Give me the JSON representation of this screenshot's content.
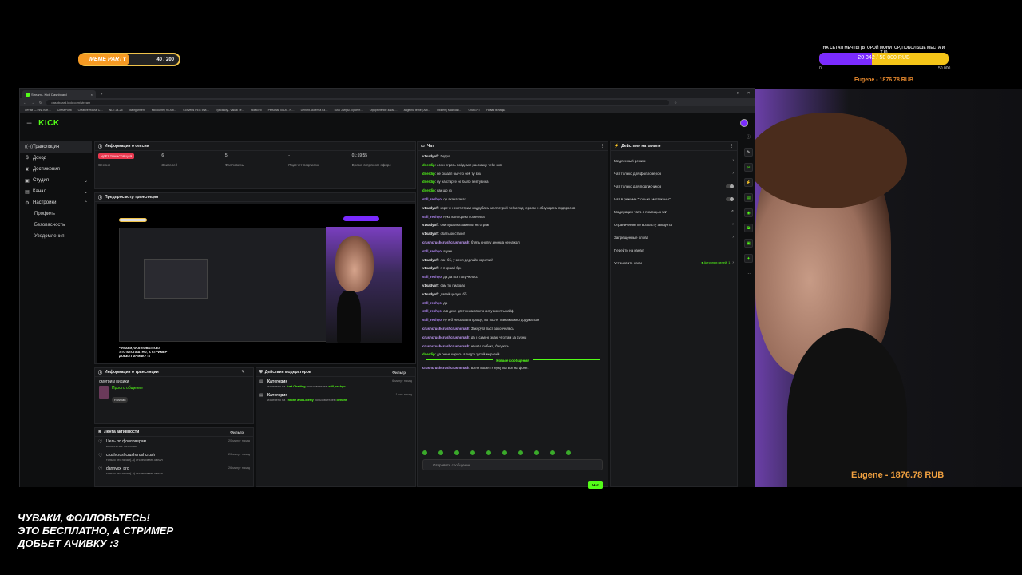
{
  "overlay": {
    "meme_label": "MEME PARTY",
    "meme_count": "40 / 200",
    "goal_title": "НА СЕТАП МЕЧТЫ (ВТОРОЙ МОНИТОР, ПОБОЛЬШЕ МЕСТА И Т.Д)",
    "goal_text": "20 342 / 50 000 RUB",
    "goal_progress": 0.41,
    "goal_min": "0",
    "goal_max": "50 000",
    "goal_donor": "Eugene - 1876.78 RUB",
    "cam_donor": "Eugene - 1876.78 RUB",
    "bottom_line1": "ЧУВАКИ, ФОЛЛОВЬТЕСЬ!",
    "bottom_line2": "ЭТО БЕСПЛАТНО, А СТРИМЕР",
    "bottom_line3": "ДОБЬЕТ АЧИВКУ :3"
  },
  "browser": {
    "tab_title": "Stream - Kick Dashboard",
    "url": "dashboard.kick.com/stream",
    "bookmarks": [
      "Летим — Inna Кон…",
      "ChessPoint",
      "Creative House C…",
      "NLE 24-25",
      "Mailfgarment",
      "Midjourney 96 Arti…",
      "Converts PEG Ima…",
      "Eyecandy - Visual Te…",
      "Новости",
      "Personal To Do - N…",
      "Dendrit Akdemia Kli…",
      "DAO 2 игры. Проект…",
      "Оформление заказ…",
      "angelina teme | Arti…",
      "Обмен | Майбокс…",
      "ChatGPT",
      "Новая вкладка"
    ]
  },
  "kick": {
    "logo": "KICK",
    "sidebar": [
      {
        "label": "Трансляция",
        "icon": "broadcast-icon"
      },
      {
        "label": "Доход",
        "icon": "dollar-icon"
      },
      {
        "label": "Достижения",
        "icon": "trophy-icon"
      },
      {
        "label": "Студия",
        "icon": "studio-icon"
      },
      {
        "label": "Канал",
        "icon": "channel-icon"
      },
      {
        "label": "Настройки",
        "icon": "gear-icon"
      }
    ],
    "settings_sub": [
      "Профиль",
      "Безопасность",
      "Уведомления"
    ],
    "session": {
      "title": "Информация о сессии",
      "live": "ИДЁТ ТРАНСЛЯЦИЯ",
      "session_label": "Сессия",
      "viewers": "6",
      "viewers_label": "Зрителей",
      "followers": "5",
      "followers_label": "Фолловеры",
      "subs": "-",
      "subs_label": "Подсчет подписок",
      "time": "01:59:55",
      "time_label": "Время в прямом эфире"
    },
    "preview": {
      "title": "Предпросмотр трансляции",
      "overlay_text_1": "ЧУВАКИ, ФОЛЛОВЬТЕСЬ!",
      "overlay_text_2": "ЭТО БЕСПЛАТНО, А СТРИМЕР",
      "overlay_text_3": "ДОБЬЕТ АЧИВКУ :3"
    },
    "stream_info": {
      "title": "Информация о трансляции",
      "stream_title": "смотрим видики",
      "category": "Просто общение",
      "tag": "Russian"
    },
    "mod_actions": {
      "title": "Действия модераторов",
      "filter": "Фильтр",
      "rows": [
        {
          "title": "Категория",
          "prefix": "изменено на",
          "value": "Just Chatting",
          "mid": "пользователем",
          "user": "still_reshyo",
          "time": "6 минут назад"
        },
        {
          "title": "Категория",
          "prefix": "изменено на",
          "value": "Throne and Liberty",
          "mid": "пользователем",
          "user": "dendrit",
          "time": "1 час назад"
        }
      ]
    },
    "activity": {
      "title": "Лента активности",
      "filter": "Фильтр",
      "rows": [
        {
          "title": "Цель по фолловерам",
          "desc": "исполнение гипотезы",
          "time": "20 минут назад",
          "icon": "heart-icon"
        },
        {
          "title": "crushcrushcrushcrushcrush",
          "desc": "только что начал(-а) отслеживать канал",
          "time": "20 минут назад",
          "icon": "heart-icon"
        },
        {
          "title": "dannyxx_pro",
          "desc": "только что начал(-а) отслеживать канал",
          "time": "26 минут назад",
          "icon": "heart-icon"
        }
      ]
    },
    "chat": {
      "title": "Чат",
      "messages": [
        {
          "user": "v1sadyoff",
          "color": "#e8e8e8",
          "text": "Гидро"
        },
        {
          "user": "dnerdip",
          "color": "#53fc18",
          "text": "если играть пойдем я расскажу тебе вхм"
        },
        {
          "user": "dnerdip",
          "color": "#53fc18",
          "text": "не сказал бы что ней ту вхм"
        },
        {
          "user": "dnerdip",
          "color": "#53fc18",
          "text": "ну на старте не было пейтувина"
        },
        {
          "user": "dnerdip",
          "color": "#53fc18",
          "text": "как щр хз"
        },
        {
          "user": "still_reshyo",
          "color": "#b98cff",
          "text": "ор ахахахахах"
        },
        {
          "user": "v1sadyoff",
          "color": "#e8e8e8",
          "text": "короче некст стрим подрубаем меллстрой лейм под героем и обсуждаем пидоросов"
        },
        {
          "user": "still_reshyo",
          "color": "#b98cff",
          "text": "нука категорию поменяла"
        },
        {
          "user": "v1sadyoff",
          "color": "#e8e8e8",
          "text": "сни пушкина заметки на страм"
        },
        {
          "user": "v1sadyoff",
          "color": "#e8e8e8",
          "text": "обать ок стали!"
        },
        {
          "user": "crushcrushcrushcrushcrush",
          "color": "#c9a0ff",
          "text": "блять кнопку анониа не нажал"
        },
        {
          "user": "still_reshyo",
          "color": "#b98cff",
          "text": "я уже"
        },
        {
          "user": "v1sadyoff",
          "color": "#e8e8e8",
          "text": "лан бб, у меня дедлайн короткий"
        },
        {
          "user": "v1sadyoff",
          "color": "#e8e8e8",
          "text": "я п краай бро"
        },
        {
          "user": "still_reshyo",
          "color": "#b98cff",
          "text": "да да все получилось"
        },
        {
          "user": "v1sadyoff",
          "color": "#e8e8e8",
          "text": "сам ты пидорас"
        },
        {
          "user": "v1sadyoff",
          "color": "#e8e8e8",
          "text": "давай целую, бб"
        },
        {
          "user": "still_reshyo",
          "color": "#b98cff",
          "text": "да"
        },
        {
          "user": "still_reshyo",
          "color": "#b98cff",
          "text": "а в деке цвет ника своего могу менять хайф"
        },
        {
          "user": "still_reshyo",
          "color": "#b98cff",
          "text": "ну я б не сказала проще, но после твича можно додуматься"
        },
        {
          "user": "crushcrushcrushcrushcrush",
          "color": "#c9a0ff",
          "text": "Закеруга паст закончилась"
        },
        {
          "user": "crushcrushcrushcrushcrush",
          "color": "#c9a0ff",
          "text": "да я сам не знаю что там за духны"
        },
        {
          "user": "crushcrushcrushcrushcrush",
          "color": "#c9a0ff",
          "text": "нашёл пабокс, балуюсь"
        },
        {
          "user": "dnerdip",
          "color": "#53fc18",
          "text": "да он не король а гидро тупой меразий"
        }
      ],
      "new_messages_label": "Новые сообщения",
      "after_new": {
        "user": "crushcrushcrushcrushcrush",
        "color": "#c9a0ff",
        "text": "всё я пошёл я ерку вы все на фоне."
      },
      "input_placeholder": "Отправить сообщение",
      "send_label": "Чат"
    },
    "channel_actions": {
      "title": "Действия на канале",
      "rows": [
        {
          "label": "Медленный режим",
          "kind": "chevron"
        },
        {
          "label": "Чат только для фолловеров",
          "kind": "chevron"
        },
        {
          "label": "Чат только для подписчиков",
          "kind": "toggle"
        },
        {
          "label": "Чат в режиме \"только эмотиконы\"",
          "kind": "toggle"
        },
        {
          "label": "Модерация чата с помощью ИИ",
          "kind": "external"
        },
        {
          "label": "Ограничение по возрасту аккаунта",
          "kind": "chevron"
        },
        {
          "label": "Запрещенные слова",
          "kind": "chevron"
        },
        {
          "label": "Перейти на канал",
          "kind": "none"
        },
        {
          "label": "Установить цели",
          "kind": "active",
          "status": "Активных целей: 1"
        }
      ]
    }
  }
}
